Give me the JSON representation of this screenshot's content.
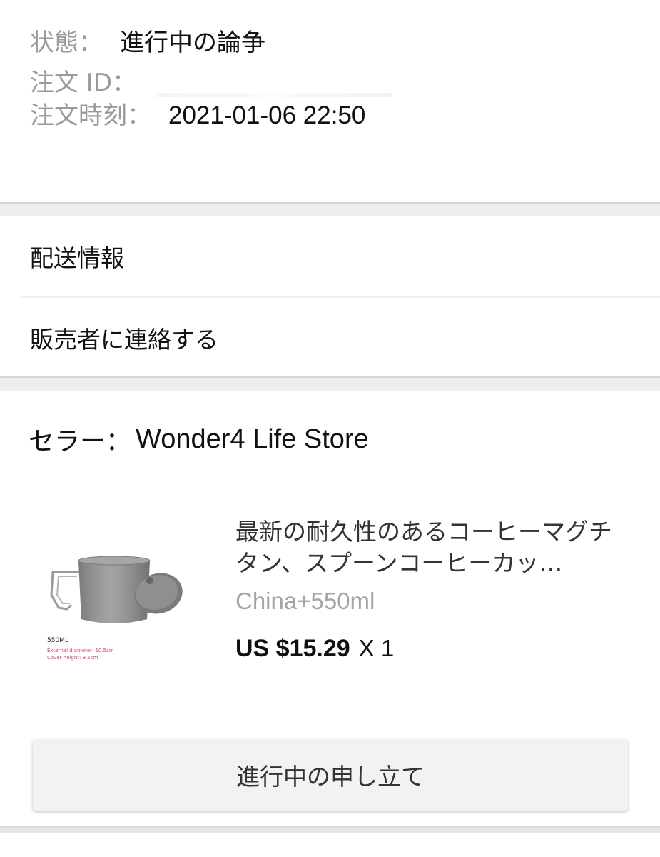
{
  "order": {
    "status_label": "状態",
    "status_value": "進行中の論争",
    "id_label": "注文 ID",
    "id_value": "",
    "time_label": "注文時刻",
    "time_value": "2021-01-06 22:50",
    "colon": "："
  },
  "links": {
    "shipping": "配送情報",
    "contact_seller": "販売者に連絡する"
  },
  "seller": {
    "label": "セラー：",
    "name": "Wonder4 Life Store"
  },
  "product": {
    "title": "最新の耐久性のあるコーヒーマグチタン、スプーンコーヒーカッ…",
    "variant": "China+550ml",
    "price": "US $15.29",
    "quantity": "X 1",
    "image_caption": "550ML",
    "image_spec_1": "External diameter: 10.5cm",
    "image_spec_2": "Cover height: 8.5cm"
  },
  "actions": {
    "dispute_button": "進行中の申し立て"
  }
}
